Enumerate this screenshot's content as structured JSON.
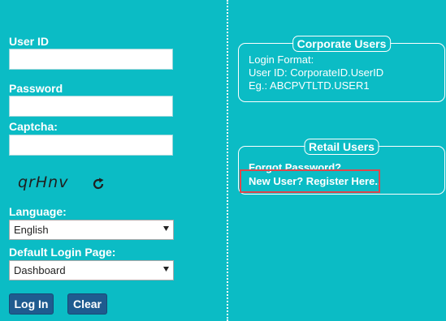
{
  "login_form": {
    "user_id_label": "User ID",
    "user_id_value": "",
    "password_label": "Password",
    "password_value": "",
    "captcha_label": "Captcha:",
    "captcha_value": "",
    "captcha_text": "qrHnv",
    "refresh_icon": "refresh-icon",
    "language_label": "Language:",
    "language_selected": "English",
    "default_page_label": "Default Login Page:",
    "default_page_selected": "Dashboard",
    "login_button": "Log In",
    "clear_button": "Clear"
  },
  "corporate_panel": {
    "title": "Corporate Users",
    "line1": "Login Format:",
    "line2": "User ID: CorporateID.UserID",
    "line3": "Eg.: ABCPVTLTD.USER1"
  },
  "retail_panel": {
    "title": "Retail Users",
    "forgot_password": "Forgot Password?",
    "new_user": "New User? Register Here.."
  },
  "colors": {
    "background": "#0bbcc5",
    "button": "#1f5b8f",
    "highlight": "#e0464b"
  }
}
